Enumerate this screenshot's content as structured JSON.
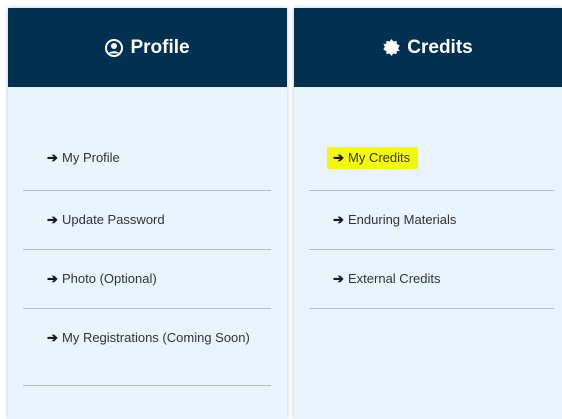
{
  "profile": {
    "title": "Profile",
    "icon": "user-circle-icon",
    "items": [
      {
        "label": "My Profile"
      },
      {
        "label": "Update Password"
      },
      {
        "label": "Photo (Optional)"
      },
      {
        "label": "My Registrations (Coming Soon)"
      }
    ]
  },
  "credits": {
    "title": "Credits",
    "icon": "gear-badge-icon",
    "items": [
      {
        "label": "My Credits",
        "highlighted": true
      },
      {
        "label": "Enduring Materials"
      },
      {
        "label": "External Credits"
      }
    ]
  },
  "colors": {
    "header_bg": "#003150",
    "panel_bg": "#e8f3fd",
    "highlight": "#f3f900"
  }
}
